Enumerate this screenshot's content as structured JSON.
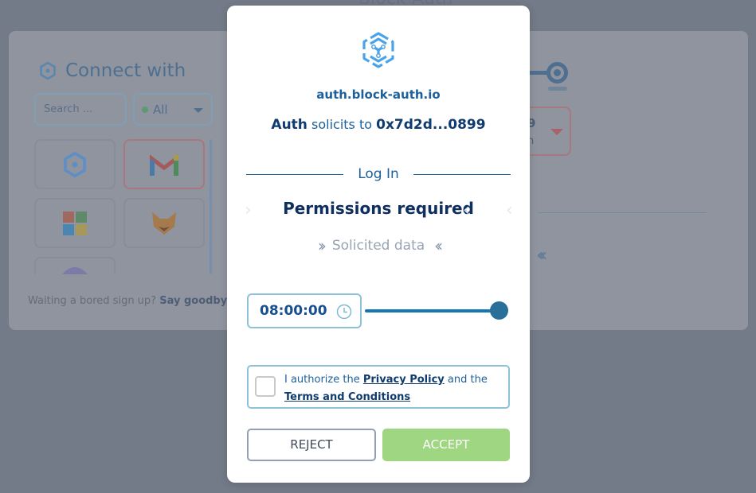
{
  "background": {
    "top_title": "Block-Auth",
    "connect_title": "Connect with",
    "search_placeholder": "Search ...",
    "filter_value": "All",
    "providers": [
      {
        "name": "block-auth-icon"
      },
      {
        "name": "gmail-icon"
      },
      {
        "name": "microsoft-icon"
      },
      {
        "name": "metamask-icon"
      },
      {
        "name": "other-provider-icon"
      }
    ],
    "footer_text": "Waiting a bored sign up?",
    "footer_bold": "Say goodbye t",
    "right_select_number": "9",
    "right_select_sub": "n"
  },
  "modal": {
    "domain": "auth.block-auth.io",
    "solicit_app": "Auth",
    "solicit_mid": "solicits to",
    "solicit_address": "0x7d2d...0899",
    "divider_label": "Log In",
    "step_current": "Permissions required",
    "step_next": "Solicited data",
    "time_value": "08:00:00",
    "slider_value_percent": 100,
    "agree_prefix": "I authorize the",
    "privacy_link": "Privacy Policy",
    "agree_mid": "and the",
    "terms_link": "Terms and Conditions",
    "agree_checked": false,
    "reject_label": "REJECT",
    "accept_label": "ACCEPT"
  },
  "colors": {
    "primary": "#1d5f9a",
    "accept": "#9fd682",
    "overlay": "#737a88"
  }
}
